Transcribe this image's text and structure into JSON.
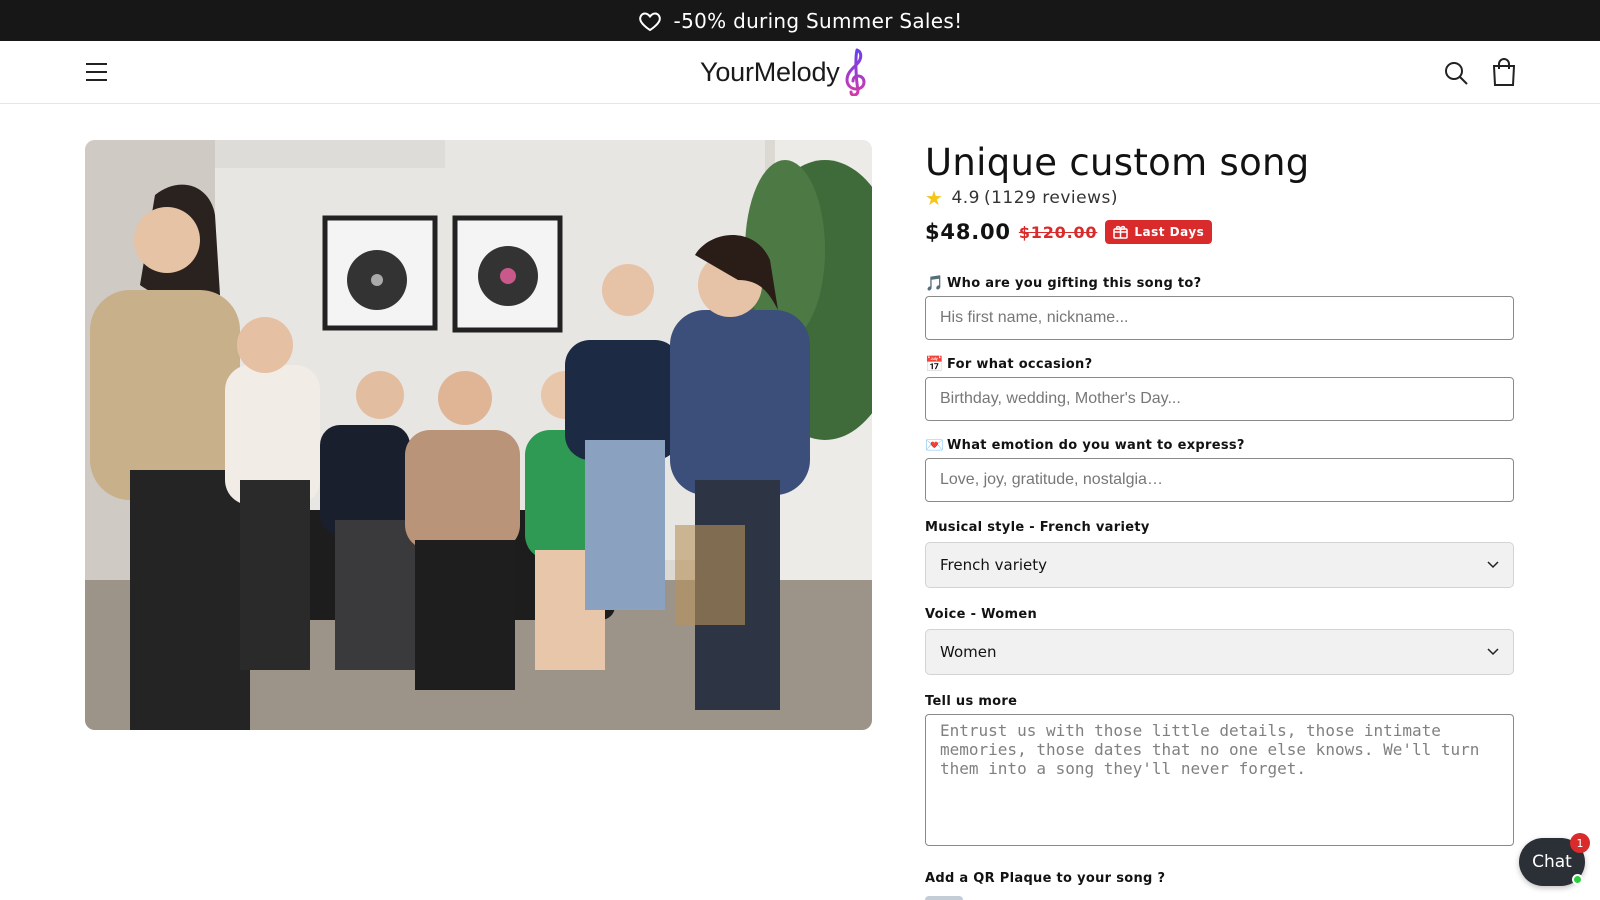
{
  "announcement": {
    "text": "-50% during Summer Sales!",
    "icon": "heart-icon"
  },
  "header": {
    "logo_text": "YourMelody",
    "logo_icon": "treble-clef-icon",
    "menu_icon": "hamburger-menu-icon",
    "search_icon": "search-icon",
    "cart_icon": "shopping-bag-icon"
  },
  "gallery": {
    "image": "team-photo"
  },
  "product": {
    "title": "Unique custom song",
    "rating": {
      "value": "4.9",
      "count_text": "(1129 reviews)"
    },
    "price": "$48.00",
    "compare_price": "$120.00",
    "badge": "Last Days"
  },
  "form": {
    "recipient": {
      "emoji": "🎵",
      "label": "Who are you gifting this song to?",
      "placeholder": "His first name, nickname..."
    },
    "occasion": {
      "emoji": "📅",
      "label": "For what occasion?",
      "placeholder": "Birthday, wedding, Mother's Day..."
    },
    "emotion": {
      "emoji": "💌",
      "label": "What emotion do you want to express?",
      "placeholder": "Love, joy, gratitude, nostalgia…"
    },
    "style": {
      "label": "Musical style - French variety",
      "value": "French variety"
    },
    "voice": {
      "label": "Voice - Women",
      "value": "Women"
    },
    "details": {
      "label": "Tell us more",
      "placeholder": "Entrust us with those little details, those intimate memories, those dates that no one else knows. We'll turn them into a song they'll never forget."
    },
    "qr": {
      "label": "Add a QR Plaque to your song ?"
    }
  },
  "chat": {
    "label": "Chat",
    "badge": "1"
  },
  "colors": {
    "sale_red": "#d92b2b",
    "announcement_bg": "#171717",
    "chat_bg": "#2b2f36"
  }
}
